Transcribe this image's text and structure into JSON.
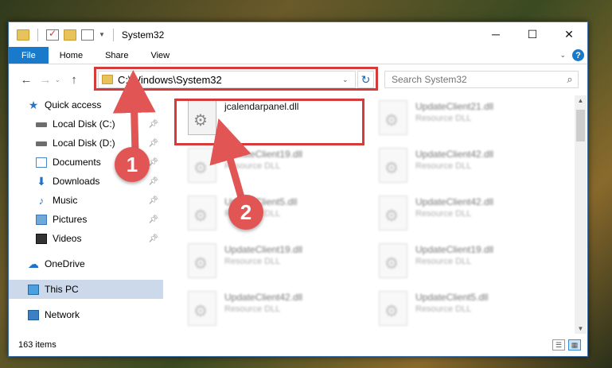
{
  "window": {
    "title": "System32",
    "controls": {
      "minimize": "─",
      "maximize": "☐",
      "close": "✕"
    }
  },
  "ribbon": {
    "tabs": [
      "File",
      "Home",
      "Share",
      "View"
    ],
    "help": "?"
  },
  "navigation": {
    "address": "C:\\Windows\\System32",
    "search_placeholder": "Search System32"
  },
  "sidebar": {
    "items": [
      {
        "label": "Quick access",
        "icon": "star-icon"
      },
      {
        "label": "Local Disk (C:)",
        "icon": "drive-icon",
        "pinned": true
      },
      {
        "label": "Local Disk (D:)",
        "icon": "drive-icon",
        "pinned": true
      },
      {
        "label": "Documents",
        "icon": "documents-icon",
        "pinned": true
      },
      {
        "label": "Downloads",
        "icon": "downloads-icon",
        "pinned": true
      },
      {
        "label": "Music",
        "icon": "music-icon",
        "pinned": true
      },
      {
        "label": "Pictures",
        "icon": "pictures-icon",
        "pinned": true
      },
      {
        "label": "Videos",
        "icon": "videos-icon",
        "pinned": true
      },
      {
        "label": "OneDrive",
        "icon": "onedrive-icon"
      },
      {
        "label": "This PC",
        "icon": "this-pc-icon",
        "selected": true
      },
      {
        "label": "Network",
        "icon": "network-icon"
      }
    ]
  },
  "files": [
    {
      "name": "jcalendarpanel.dll",
      "type": ""
    },
    {
      "name": "UpdateClient21.dll",
      "type": "Resource DLL"
    },
    {
      "name": "UpdateClient19.dll",
      "type": "Resource DLL"
    },
    {
      "name": "UpdateClient42.dll",
      "type": "Resource DLL"
    },
    {
      "name": "UpdateClient5.dll",
      "type": "Resource DLL"
    },
    {
      "name": "UpdateClient42.dll",
      "type": "Resource DLL"
    },
    {
      "name": "UpdateClient19.dll",
      "type": "Resource DLL"
    },
    {
      "name": "UpdateClient19.dll",
      "type": "Resource DLL"
    },
    {
      "name": "UpdateClient42.dll",
      "type": "Resource DLL"
    },
    {
      "name": "UpdateClient5.dll",
      "type": "Resource DLL"
    }
  ],
  "status": {
    "item_count": "163 items"
  },
  "annotations": {
    "step1": "1",
    "step2": "2",
    "color": "#d63b3b"
  }
}
